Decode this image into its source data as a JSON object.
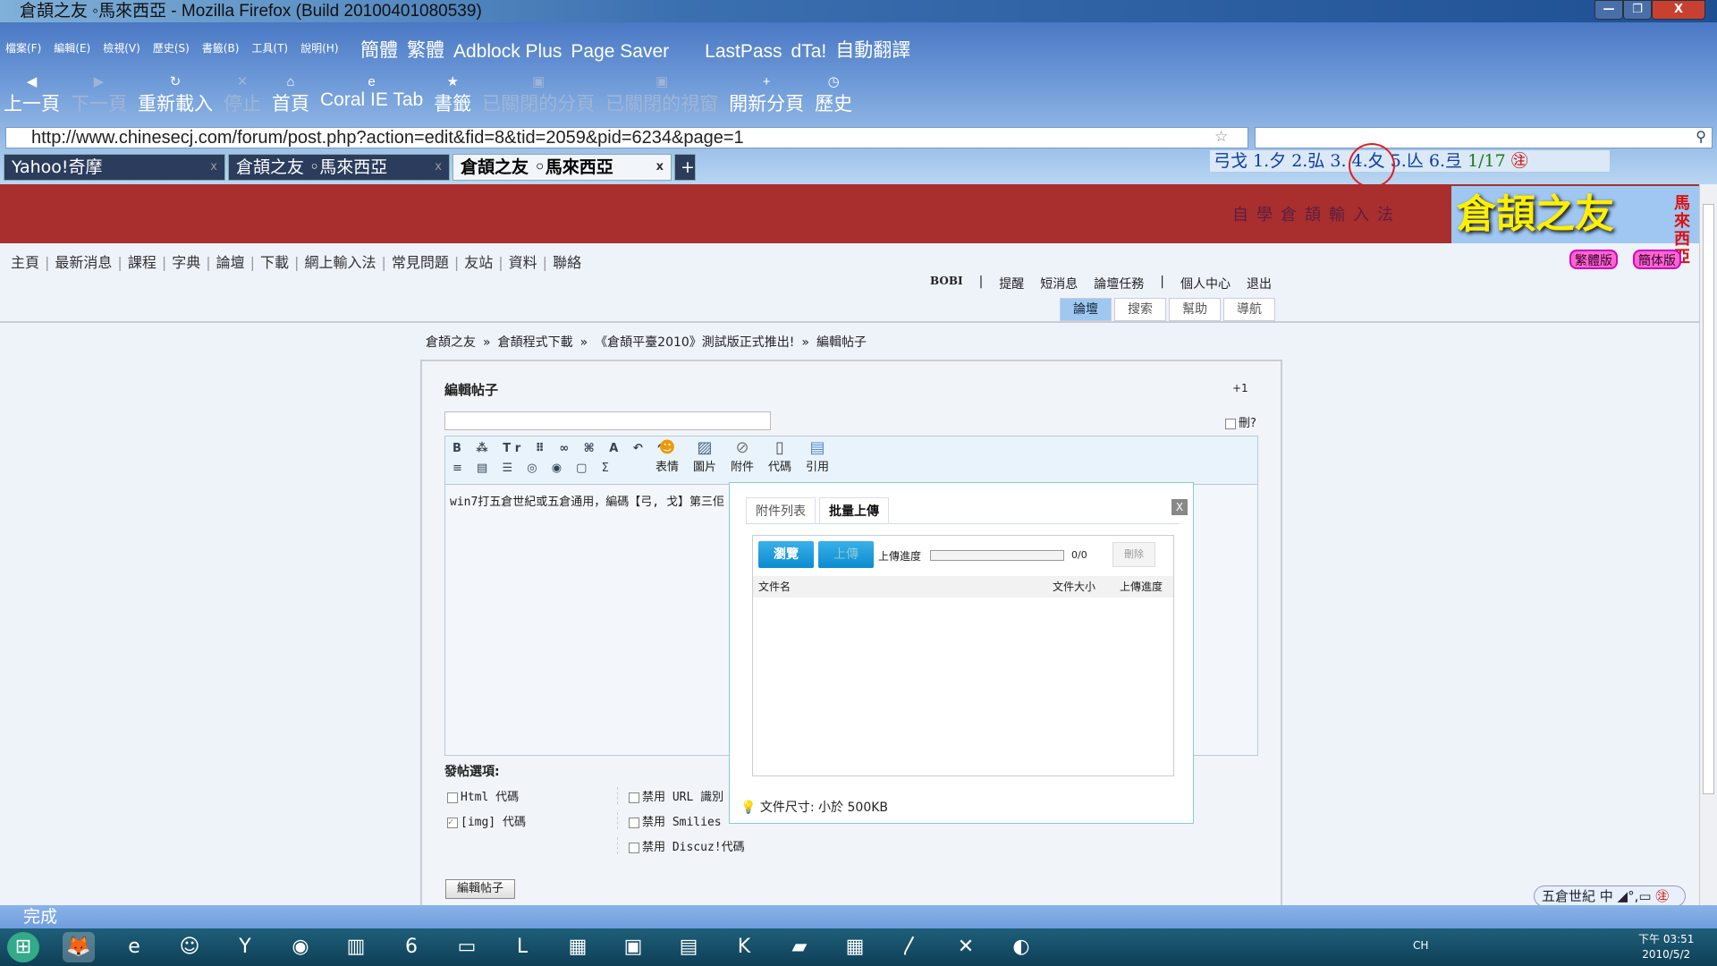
{
  "window": {
    "title": "倉頡之友 ◦馬來西亞 - Mozilla Firefox (Build 20100401080539)",
    "minimize": "—",
    "restore": "❐",
    "close": "X"
  },
  "menu": [
    "檔案(F)",
    "編輯(E)",
    "檢視(V)",
    "歷史(S)",
    "書籤(B)",
    "工具(T)",
    "說明(H)"
  ],
  "toolbar1": [
    "簡體",
    "繁體",
    "Adblock Plus",
    "Page Saver",
    "LastPass",
    "dTa!",
    "自動翻譯"
  ],
  "toolbar2": [
    {
      "label": "上一頁",
      "icon": "◀",
      "enabled": true
    },
    {
      "label": "下一頁",
      "icon": "▶",
      "enabled": false
    },
    {
      "label": "重新載入",
      "icon": "↻",
      "enabled": true
    },
    {
      "label": "停止",
      "icon": "✕",
      "enabled": false
    },
    {
      "label": "首頁",
      "icon": "⌂",
      "enabled": true
    },
    {
      "label": "Coral IE Tab",
      "icon": "e",
      "enabled": true
    },
    {
      "label": "書籤",
      "icon": "★",
      "enabled": true
    },
    {
      "label": "已關閉的分頁",
      "icon": "▣",
      "enabled": false
    },
    {
      "label": "已關閉的視窗",
      "icon": "▣",
      "enabled": false
    },
    {
      "label": "開新分頁",
      "icon": "+",
      "enabled": true
    },
    {
      "label": "歷史",
      "icon": "◷",
      "enabled": true
    }
  ],
  "url": "http://www.chinesecj.com/forum/post.php?action=edit&fid=8&tid=2059&pid=6234&page=1",
  "tabs": [
    {
      "label": "Yahoo!奇摩"
    },
    {
      "label": "倉頡之友 ◦馬來西亞"
    },
    {
      "label": "倉頡之友 ◦馬來西亞",
      "active": true
    }
  ],
  "tab_close": "x",
  "new_tab": "+",
  "ime_candidates": "弓戈 1.夕 2.弘 3.  4.夂 5.亾 6.弖",
  "ime_page": "1/17",
  "site": {
    "slogan": "自學倉頡輸入法",
    "logo": "倉頡之友",
    "logo_sub": "馬來西亞",
    "accent": "#a92e2e"
  },
  "nav": [
    "主頁",
    "最新消息",
    "課程",
    "字典",
    "論壇",
    "下載",
    "網上輸入法",
    "常見問題",
    "友站",
    "資料",
    "聯絡"
  ],
  "lang": [
    "繁體版",
    "簡体版"
  ],
  "user": [
    "BOBI",
    "|",
    "提醒",
    "短消息",
    "論壇任務",
    "|",
    "個人中心",
    "退出"
  ],
  "forum_tabs": [
    "論壇",
    "搜索",
    "幫助",
    "導航"
  ],
  "breadcrumb": [
    "倉頡之友",
    "»",
    "倉頡程式下載",
    "»",
    "《倉頡平臺2010》測試版正式推出!",
    "»",
    "編輯帖子"
  ],
  "post": {
    "title": "編輯帖子",
    "plus": "+1",
    "delete_label": "刪?",
    "content": "win7打五倉世紀或五倉通用，編碼【弓, 戈】第三佢",
    "submit": "編輯帖子"
  },
  "editor_buttons": [
    "表情",
    "圖片",
    "附件",
    "代碼",
    "引用"
  ],
  "dialog": {
    "tabs": [
      "附件列表",
      "批量上傳"
    ],
    "close": "X",
    "browse": "瀏覽",
    "upload": "上傳",
    "progress_label": "上傳進度",
    "progress": 0,
    "count": "0/0",
    "delete": "刪除",
    "columns": [
      "文件名",
      "文件大小",
      "上傳進度"
    ],
    "size_note": "文件尺寸: 小於 500KB"
  },
  "options": {
    "title": "發帖選項:",
    "items": [
      {
        "label": "Html 代碼",
        "checked": false
      },
      {
        "label": "[img] 代碼",
        "checked": true
      },
      {
        "label": "禁用 URL 識別",
        "checked": false
      },
      {
        "label": "禁用 Smilies",
        "checked": false
      },
      {
        "label": "禁用 Discuz!代碼",
        "checked": false
      }
    ]
  },
  "statusbar": "完成",
  "ime_toolbar": "五倉世紀 中 ◢°,▭",
  "clock": {
    "time": "下午 03:51",
    "date": "2010/5/2"
  },
  "tray": "CH"
}
